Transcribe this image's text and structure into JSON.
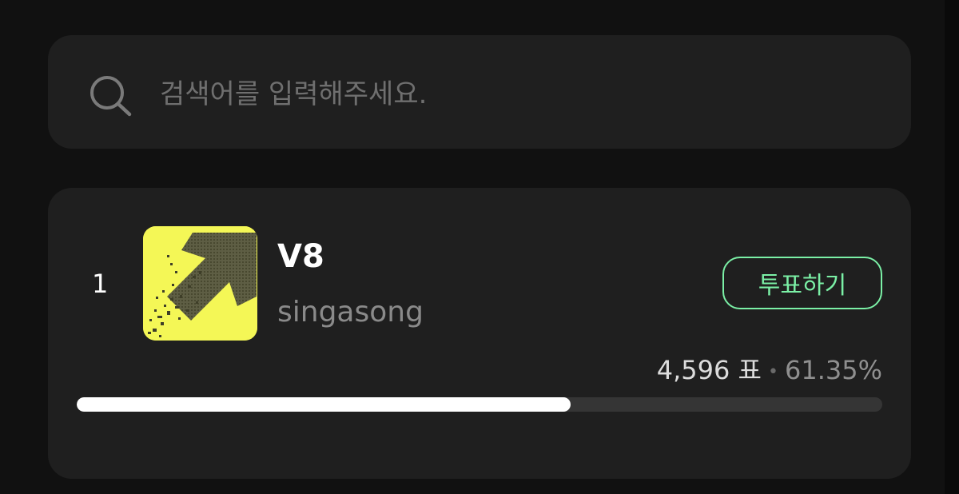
{
  "search": {
    "placeholder": "검색어를 입력해주세요.",
    "icon": "search-icon"
  },
  "list": [
    {
      "rank": "1",
      "title": "V8",
      "artist": "singasong",
      "cover_icon": "arrow-up-right-icon",
      "cover_color": "#f4f756",
      "vote_button_label": "투표하기",
      "votes_text": "4,596 표",
      "separator": "•",
      "percent_text": "61.35%",
      "progress_fraction": 0.6135
    }
  ],
  "colors": {
    "accent": "#7bf0a6",
    "background": "#111111",
    "card": "#1f1f1f",
    "progress_fill": "#ffffff",
    "progress_track": "#353535"
  }
}
